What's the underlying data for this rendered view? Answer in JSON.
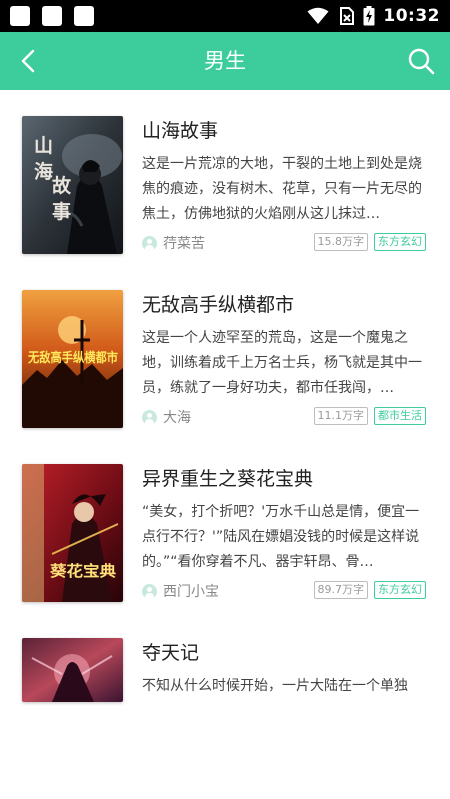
{
  "status_bar": {
    "time": "10:32",
    "icons": [
      "notification-icon",
      "notification-icon",
      "notification-icon",
      "wifi-icon",
      "no-sim-icon",
      "battery-charging-icon"
    ]
  },
  "header": {
    "title": "男生",
    "back_icon": "chevron-left-icon",
    "search_icon": "search-icon"
  },
  "colors": {
    "accent": "#3dcc9c",
    "status_bar": "#000000"
  },
  "books": [
    {
      "title": "山海故事",
      "description": "这是一片荒凉的大地，干裂的土地上到处是烧焦的痕迹，没有树木、花草，只有一片无尽的焦土，仿佛地狱的火焰刚从这儿抹过…",
      "author": "荇菜苦",
      "word_count": "15.8万字",
      "genre": "东方玄幻",
      "cover_text": "山海故事"
    },
    {
      "title": "无敌高手纵横都市",
      "description": "这是一个人迹罕至的荒岛，这是一个魔鬼之地，训练着成千上万名士兵，杨飞就是其中一员，练就了一身好功夫，都市任我闯，…",
      "author": "大海",
      "word_count": "11.1万字",
      "genre": "都市生活",
      "cover_text": "无敌高手纵横都市"
    },
    {
      "title": "异界重生之葵花宝典",
      "description": "“美女，打个折吧？'万水千山总是情，便宜一点行不行？'”陆风在嫖娼没钱的时候是这样说的。”“看你穿着不凡、器宇轩昂、骨…",
      "author": "西门小宝",
      "word_count": "89.7万字",
      "genre": "东方玄幻",
      "cover_text": "葵花宝典"
    },
    {
      "title": "夺天记",
      "description": "不知从什么时候开始，一片大陆在一个单独",
      "author": "",
      "word_count": "",
      "genre": "",
      "cover_text": ""
    }
  ]
}
